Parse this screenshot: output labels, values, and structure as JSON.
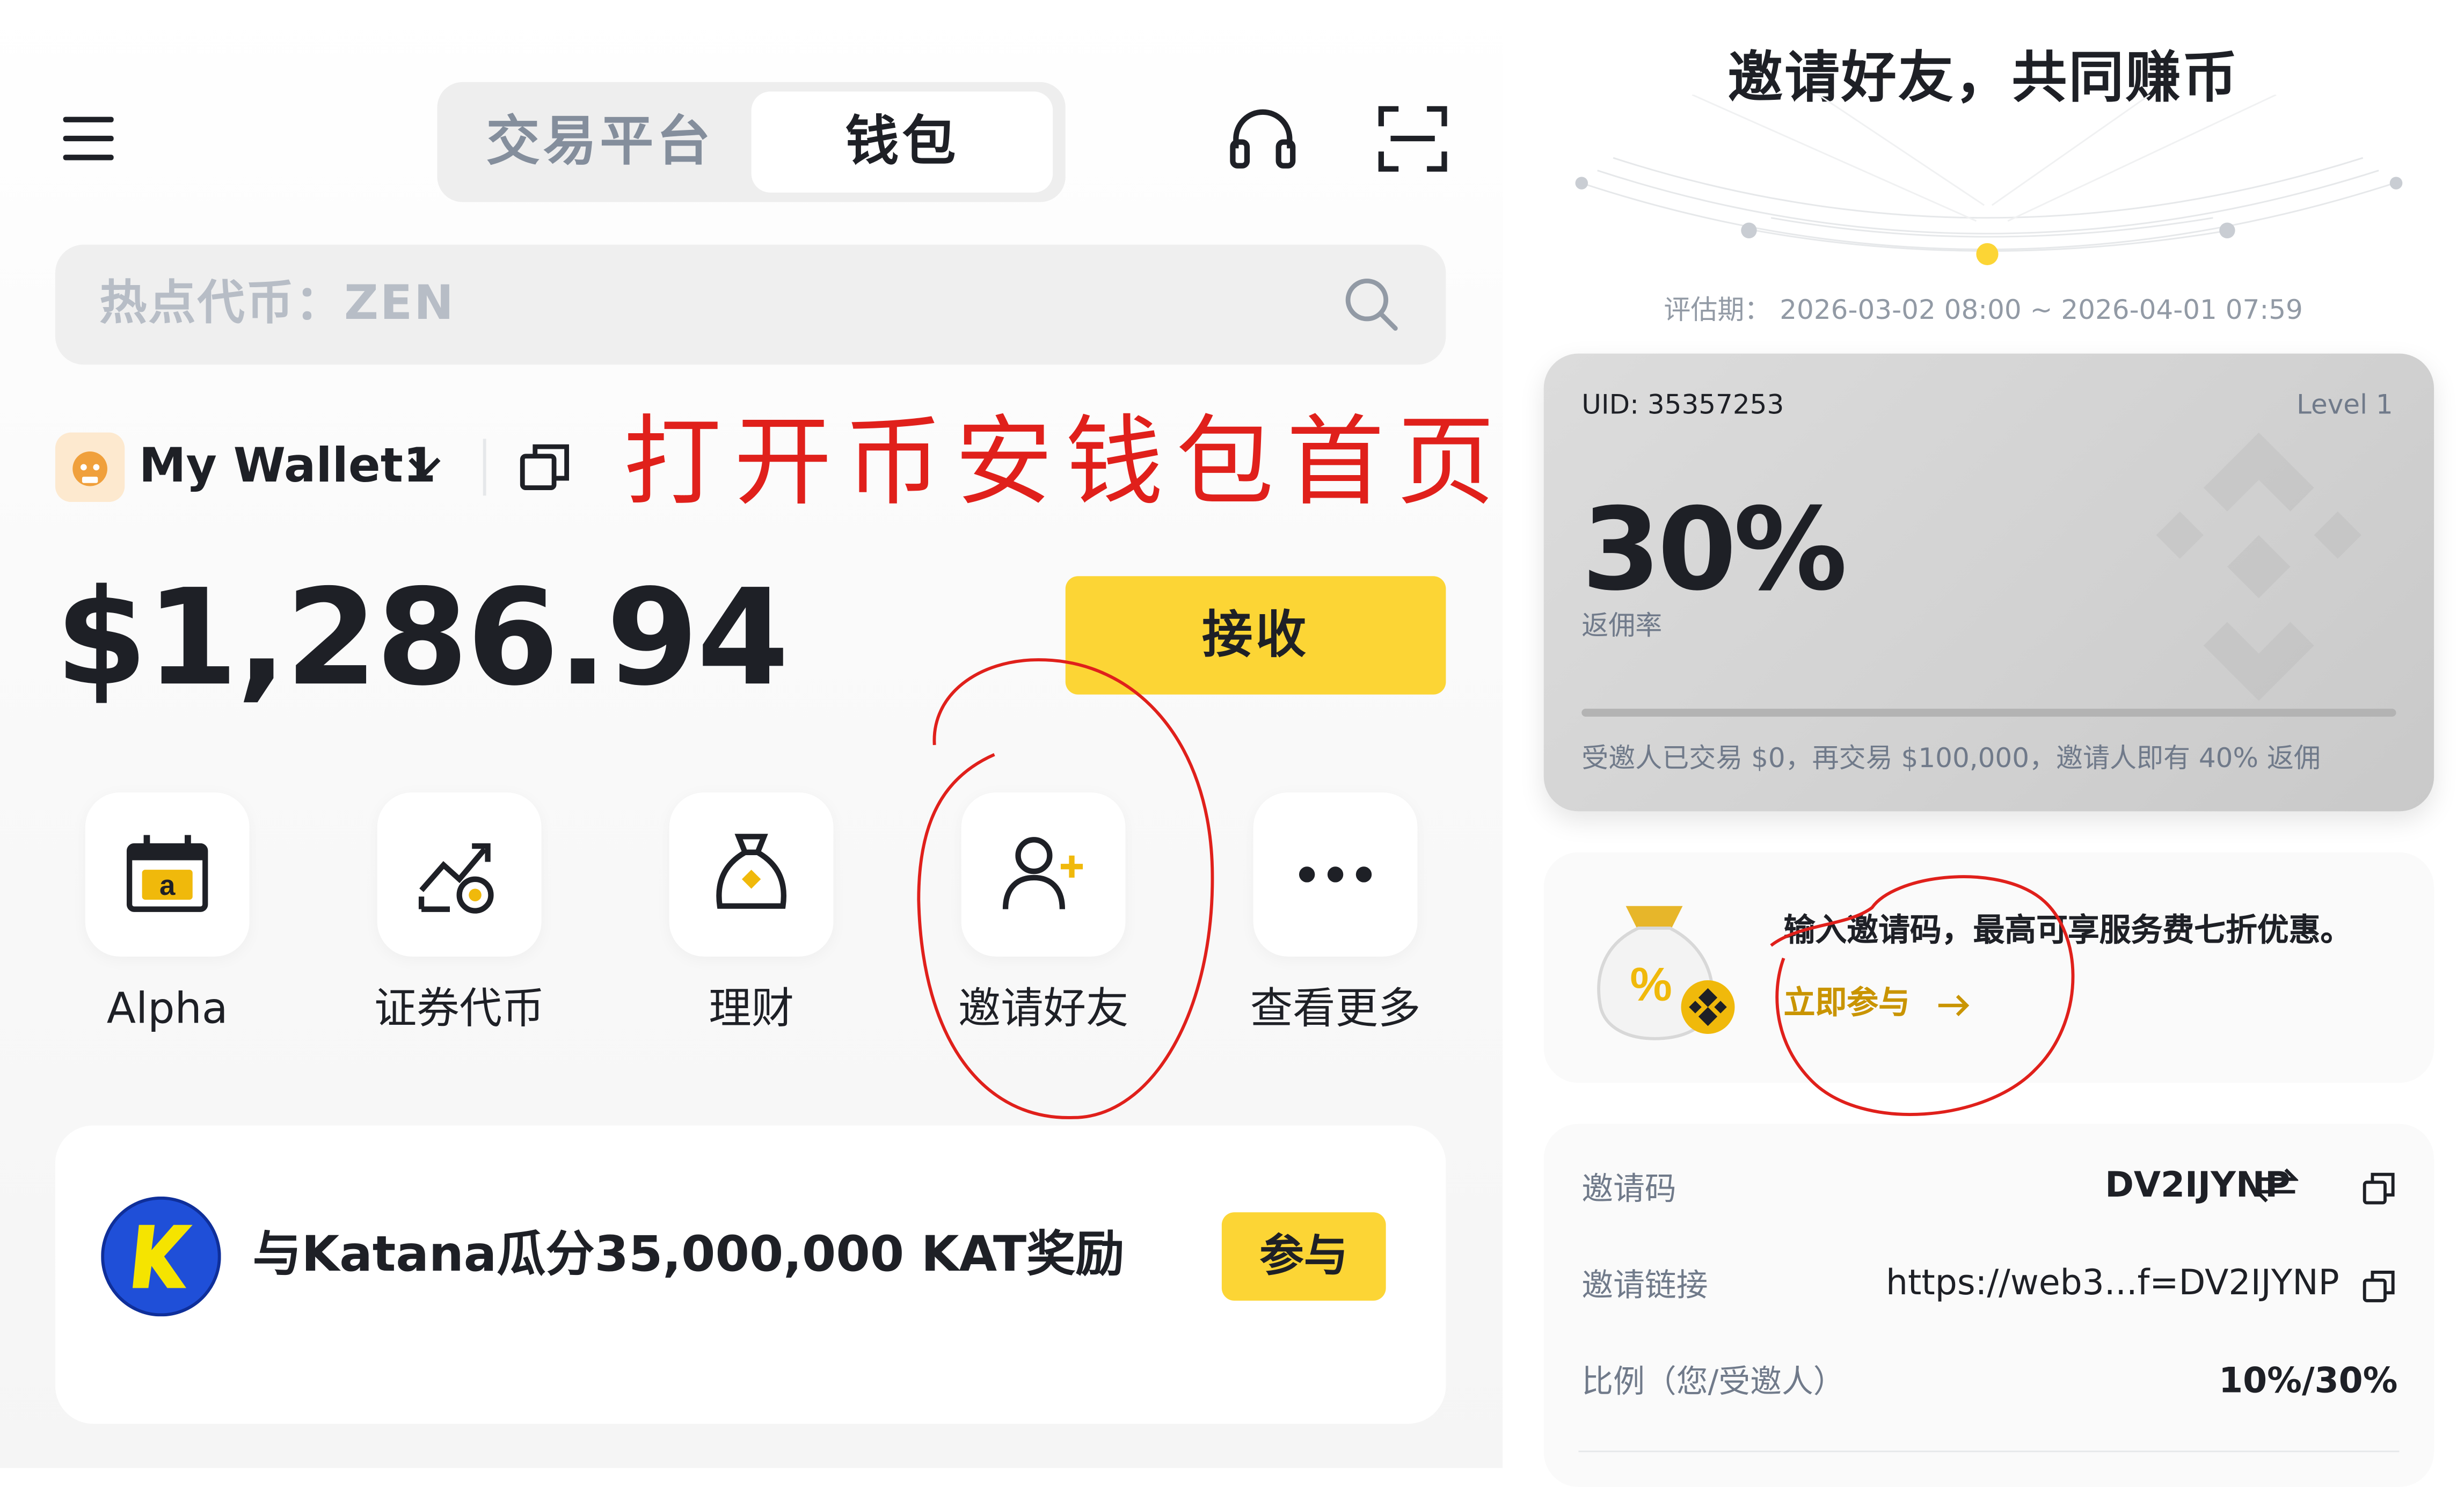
{
  "left": {
    "header": {
      "tabs": [
        "交易平台",
        "钱包"
      ],
      "active_tab": "钱包"
    },
    "search": {
      "placeholder": "热点代币：ZEN"
    },
    "wallet": {
      "name": "My Wallet1"
    },
    "handwritten_note": "打开币安钱包首页",
    "balance": "$1,286.94",
    "receive_label": "接收",
    "quick_actions": [
      {
        "label": "Alpha",
        "icon": "alpha-calendar-icon"
      },
      {
        "label": "证券代币",
        "icon": "securities-token-icon"
      },
      {
        "label": "理财",
        "icon": "finance-bag-icon"
      },
      {
        "label": "邀请好友",
        "icon": "invite-friend-icon"
      },
      {
        "label": "查看更多",
        "icon": "more-dots-icon"
      }
    ],
    "promo": {
      "text": "与Katana瓜分35,000,000 KAT奖励",
      "button": "参与"
    }
  },
  "right": {
    "title": "邀请好友，共同赚币",
    "period": "评估期： 2026-03-02 08:00 ~ 2026-04-01 07:59",
    "card": {
      "uid": "UID: 35357253",
      "level": "Level 1",
      "rate": "30%",
      "rate_label": "返佣率",
      "progress_fraction": 0,
      "note": "受邀人已交易 $0，再交易 $100,000，邀请人即有 40% 返佣"
    },
    "invite_code_promo": {
      "text": "输入邀请码，最高可享服务费七折优惠。",
      "link": "立即参与"
    },
    "rows": [
      {
        "label": "邀请码",
        "value": "DV2IJYNP"
      },
      {
        "label": "邀请链接",
        "value": "https://web3...f=DV2IJYNP"
      },
      {
        "label": "比例（您/受邀人）",
        "value": "10%/30%"
      }
    ]
  },
  "colors": {
    "accent": "#FCD535",
    "annotation_red": "#E0201B",
    "link_gold": "#C99400"
  }
}
